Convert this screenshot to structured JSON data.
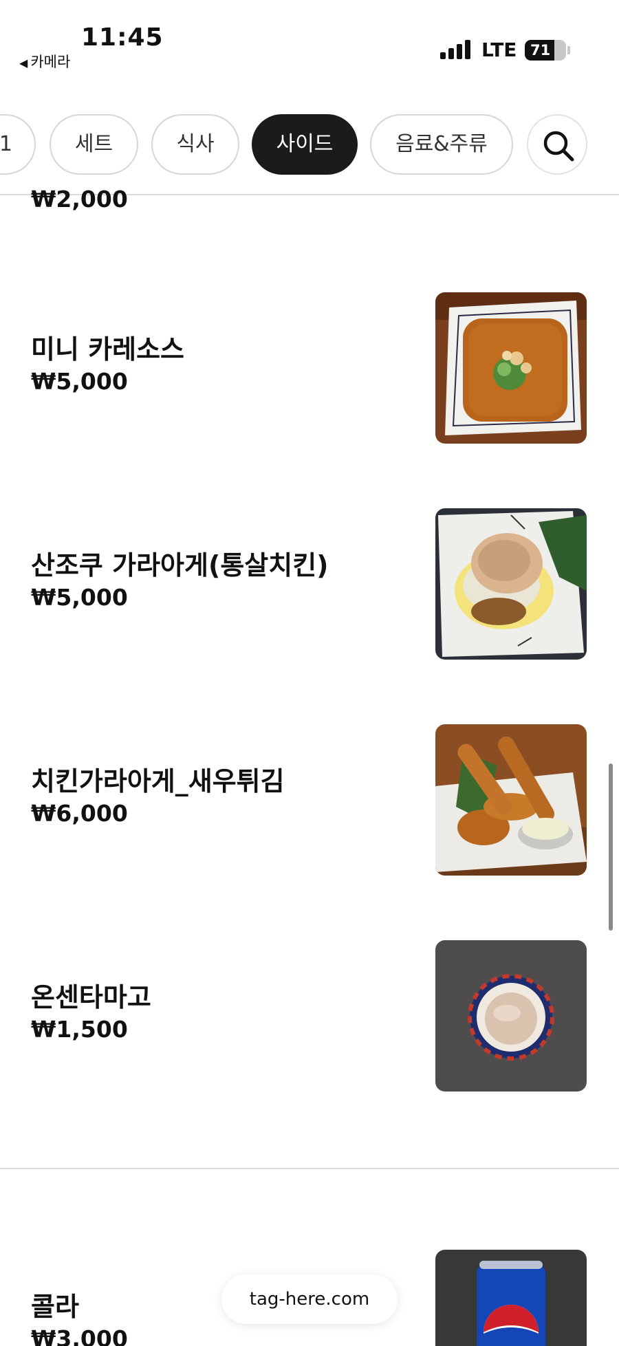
{
  "status_bar": {
    "time": "11:45",
    "back_label": "카메라",
    "back_icon": "◀",
    "network": "LTE",
    "battery_percent": 71,
    "battery_label": "71"
  },
  "tabs": [
    {
      "label": "1",
      "active": false
    },
    {
      "label": "세트",
      "active": false
    },
    {
      "label": "식사",
      "active": false
    },
    {
      "label": "사이드",
      "active": true
    },
    {
      "label": "음료&주류",
      "active": false
    }
  ],
  "search_icon": "search-icon",
  "previous_item_price": "₩2,000",
  "items": [
    {
      "name": "미니 카레소스",
      "price": "₩5,000",
      "image": "curry-sauce-photo"
    },
    {
      "name": "산조쿠 가라아게(통살치킨)",
      "price": "₩5,000",
      "image": "sanzoku-karaage-photo"
    },
    {
      "name": "치킨가라아게_새우튀김",
      "price": "₩6,000",
      "image": "chicken-shrimp-tempura-photo"
    },
    {
      "name": "온센타마고",
      "price": "₩1,500",
      "image": "onsen-tamago-photo"
    },
    {
      "name": "콜라",
      "price": "₩3,000",
      "image": "cola-can-photo"
    }
  ],
  "footer": {
    "site": "tag-here.com"
  },
  "colors": {
    "accent": "#1b1b1d",
    "divider": "#dcdcdc",
    "background": "#ffffff"
  }
}
